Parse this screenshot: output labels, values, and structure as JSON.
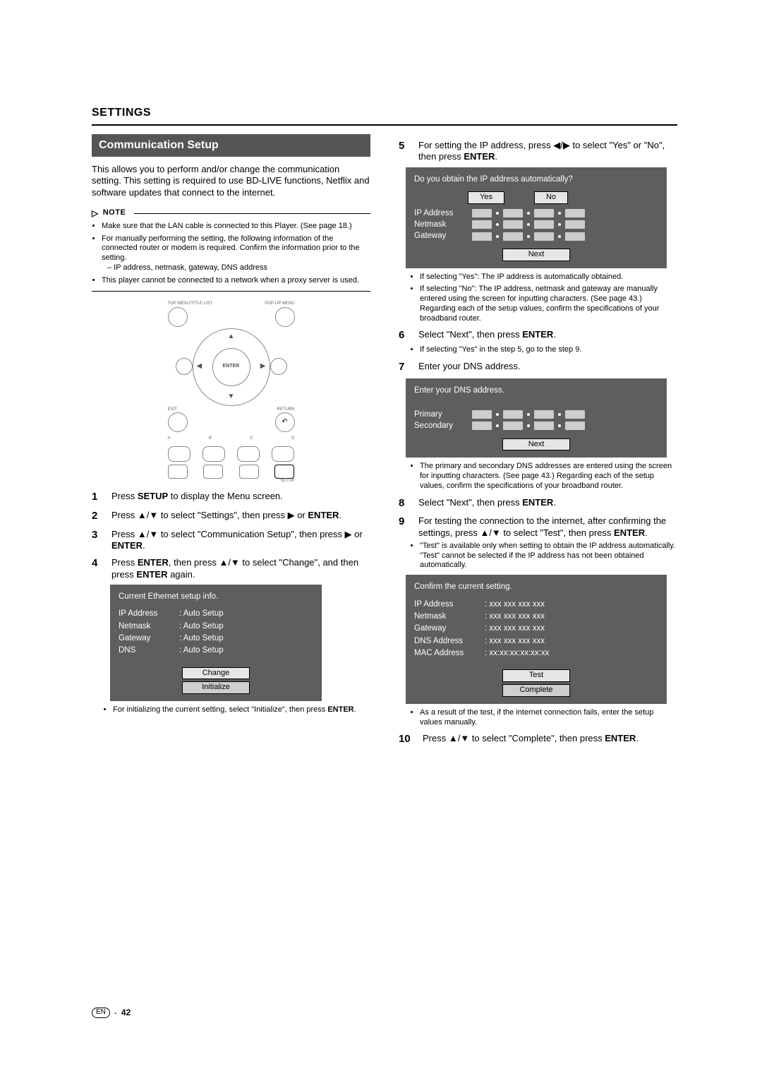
{
  "header": {
    "section": "SETTINGS"
  },
  "left": {
    "band": "Communication Setup",
    "intro": "This allows you to perform and/or change the communication setting. This setting is required to use BD-LIVE functions, Netflix and software updates that connect to the internet.",
    "note_label": "NOTE",
    "notes": [
      "Make sure that the LAN cable is connected to this Player. (See page 18.)",
      "For manually performing the setting, the following information of the connected router or modem is required. Confirm the information prior to the setting.",
      "This player cannot be connected to a network when a proxy server is used."
    ],
    "note_sub": "– IP address, netmask, gateway, DNS address",
    "remote": {
      "top_left": "TOP MENU/TITLE LIST",
      "top_right": "POP-UP MENU",
      "enter": "ENTER",
      "exit": "EXIT",
      "return": "RETURN",
      "a": "A",
      "b": "B",
      "c": "C",
      "d": "D",
      "setup": "SETUP"
    },
    "steps": {
      "s1": {
        "n": "1",
        "t1": "Press ",
        "b1": "SETUP",
        "t2": " to display the Menu screen."
      },
      "s2": {
        "n": "2",
        "t1": "Press ",
        "g1": "▲/▼",
        "t2": " to select \"Settings\", then press ",
        "g2": "▶",
        "t3": " or ",
        "b1": "ENTER",
        "t4": "."
      },
      "s3": {
        "n": "3",
        "t1": "Press ",
        "g1": "▲/▼",
        "t2": " to select \"Communication Setup\", then press ",
        "g2": "▶",
        "t3": " or ",
        "b1": "ENTER",
        "t4": "."
      },
      "s4": {
        "n": "4",
        "t1": "Press ",
        "b1": "ENTER",
        "t2": ", then press ",
        "g1": "▲/▼",
        "t3": " to select \"Change\", and then press ",
        "b2": "ENTER",
        "t4": " again."
      }
    },
    "ethpanel": {
      "title": "Current Ethernet setup info.",
      "rows": [
        {
          "k": "IP Address",
          "v": ": Auto Setup"
        },
        {
          "k": "Netmask",
          "v": ": Auto Setup"
        },
        {
          "k": "Gateway",
          "v": ": Auto Setup"
        },
        {
          "k": "DNS",
          "v": ": Auto Setup"
        }
      ],
      "btn_change": "Change",
      "btn_init": "Initialize"
    },
    "after_panel_bullet": "For initializing the current setting, select \"Initialize\", then press ENTER."
  },
  "right": {
    "s5": {
      "n": "5",
      "t1": "For setting the IP address, press ",
      "g1": "◀/▶",
      "t2": " to select \"Yes\" or \"No\", then press ",
      "b1": "ENTER",
      "t3": "."
    },
    "ippanel": {
      "q": "Do you obtain the IP address automatically?",
      "yes": "Yes",
      "no": "No",
      "rows": [
        "IP Address",
        "Netmask",
        "Gateway"
      ],
      "next": "Next"
    },
    "s5_bullets": [
      "If selecting \"Yes\": The IP address is automatically obtained.",
      "If selecting \"No\": The IP address, netmask and gateway are manually entered using the screen for inputting characters. (See page 43.) Regarding each of the setup values, confirm the specifications of your broadband router."
    ],
    "s6": {
      "n": "6",
      "t1": "Select \"Next\", then press ",
      "b1": "ENTER",
      "t2": "."
    },
    "s6_bullet": "If selecting \"Yes\" in the step 5, go to the step 9.",
    "s7": {
      "n": "7",
      "t": "Enter your DNS address."
    },
    "dnspanel": {
      "title": "Enter your DNS address.",
      "rows": [
        "Primary",
        "Secondary"
      ],
      "next": "Next"
    },
    "s7_bullet": "The primary and secondary DNS addresses are entered using the screen for inputting characters. (See page 43.) Regarding each of the setup values, confirm the specifications of your broadband router.",
    "s8": {
      "n": "8",
      "t1": "Select \"Next\", then press ",
      "b1": "ENTER",
      "t2": "."
    },
    "s9": {
      "n": "9",
      "t1": "For testing the connection to the internet, after confirming the settings, press ",
      "g1": "▲/▼",
      "t2": " to select \"Test\", then press ",
      "b1": "ENTER",
      "t3": "."
    },
    "s9_bullet": "\"Test\" is available only when setting to obtain the IP address automatically. \"Test\" cannot be selected if the IP address has not been obtained automatically.",
    "confirm": {
      "title": "Confirm the current setting.",
      "rows": [
        {
          "k": "IP Address",
          "v": ": xxx xxx xxx xxx"
        },
        {
          "k": "Netmask",
          "v": ": xxx xxx xxx xxx"
        },
        {
          "k": "Gateway",
          "v": ": xxx xxx xxx xxx"
        },
        {
          "k": "DNS Address",
          "v": ": xxx xxx xxx xxx"
        },
        {
          "k": "MAC Address",
          "v": ": xx:xx:xx:xx:xx:xx"
        }
      ],
      "test": "Test",
      "complete": "Complete"
    },
    "s9_after": "As a result of the test, if the internet connection fails, enter the setup values manually.",
    "s10": {
      "n": "10",
      "t1": "Press ",
      "g1": "▲/▼",
      "t2": " to select \"Complete\", then press ",
      "b1": "ENTER",
      "t3": "."
    }
  },
  "footer": {
    "lang": "EN",
    "page": "42"
  }
}
